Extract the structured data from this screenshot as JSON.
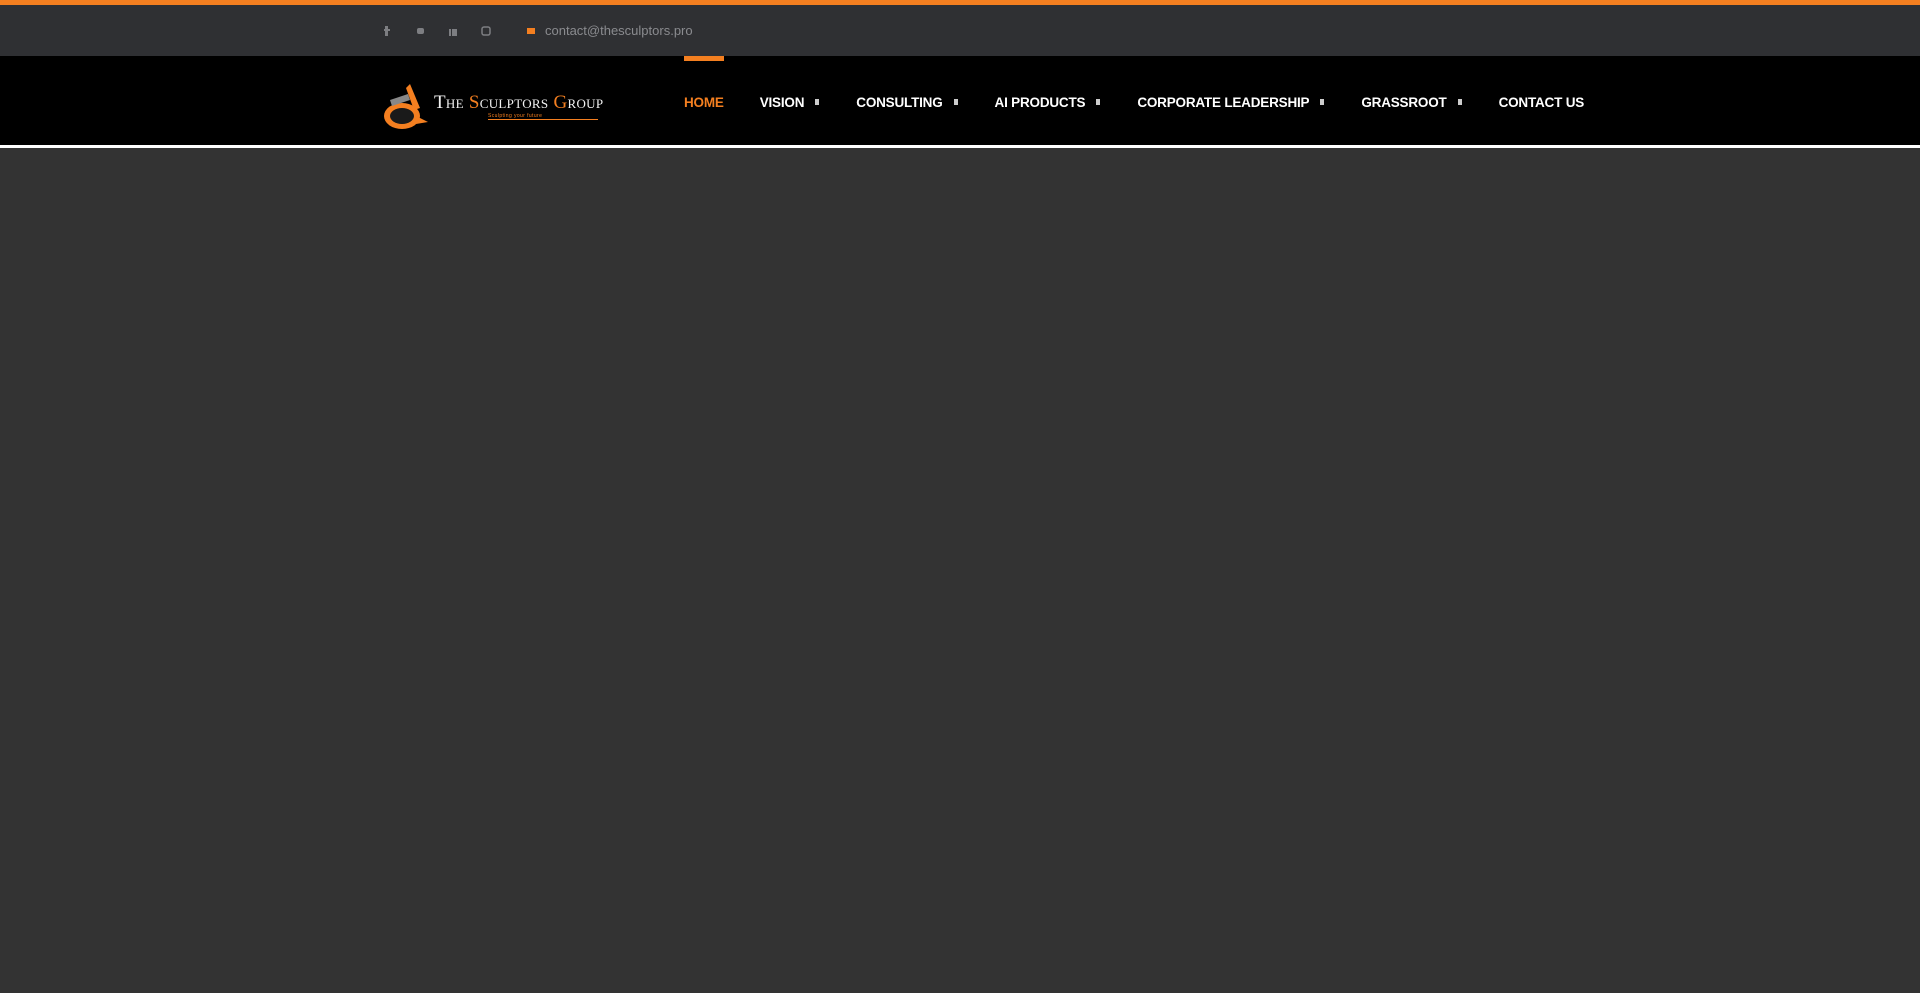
{
  "accent_color": "#f47f20",
  "top_bar": {
    "social_icons": [
      "facebook-icon",
      "twitter-icon",
      "linkedin-icon",
      "instagram-icon"
    ],
    "email": "contact@thesculptors.pro"
  },
  "logo": {
    "title_a": "The ",
    "title_b": "S",
    "title_c": "culptors ",
    "title_d": "G",
    "title_e": "roup",
    "tagline": "Sculpting your future"
  },
  "nav": {
    "items": [
      {
        "label": "HOME",
        "active": true,
        "dropdown": false
      },
      {
        "label": "VISION",
        "active": false,
        "dropdown": true
      },
      {
        "label": "CONSULTING",
        "active": false,
        "dropdown": true
      },
      {
        "label": "AI PRODUCTS",
        "active": false,
        "dropdown": true
      },
      {
        "label": "CORPORATE LEADERSHIP",
        "active": false,
        "dropdown": true
      },
      {
        "label": "GRASSROOT",
        "active": false,
        "dropdown": true
      },
      {
        "label": "CONTACT US",
        "active": false,
        "dropdown": false
      }
    ]
  }
}
